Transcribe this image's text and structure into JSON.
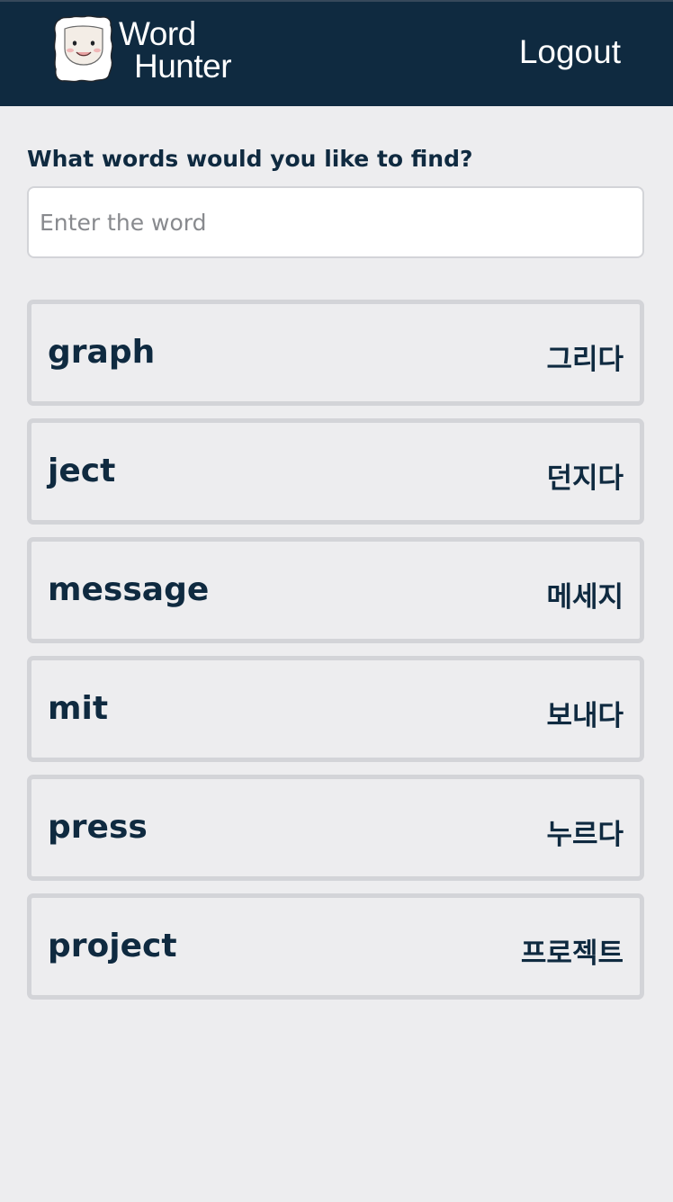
{
  "header": {
    "logo_line1": "Word",
    "logo_line2": "Hunter",
    "logo_icon": "sheep-face-icon",
    "logout_label": "Logout",
    "background_color": "#0f2a40"
  },
  "search": {
    "prompt": "What words would you like to find?",
    "value": "",
    "placeholder": "Enter the word"
  },
  "words": [
    {
      "english": "graph",
      "korean": "그리다"
    },
    {
      "english": "ject",
      "korean": "던지다"
    },
    {
      "english": "message",
      "korean": "메세지"
    },
    {
      "english": "mit",
      "korean": "보내다"
    },
    {
      "english": "press",
      "korean": "누르다"
    },
    {
      "english": "project",
      "korean": "프로젝트"
    }
  ],
  "colors": {
    "brand_navy": "#0f2a40",
    "page_background": "#ededef",
    "card_border": "#d3d4d8"
  }
}
